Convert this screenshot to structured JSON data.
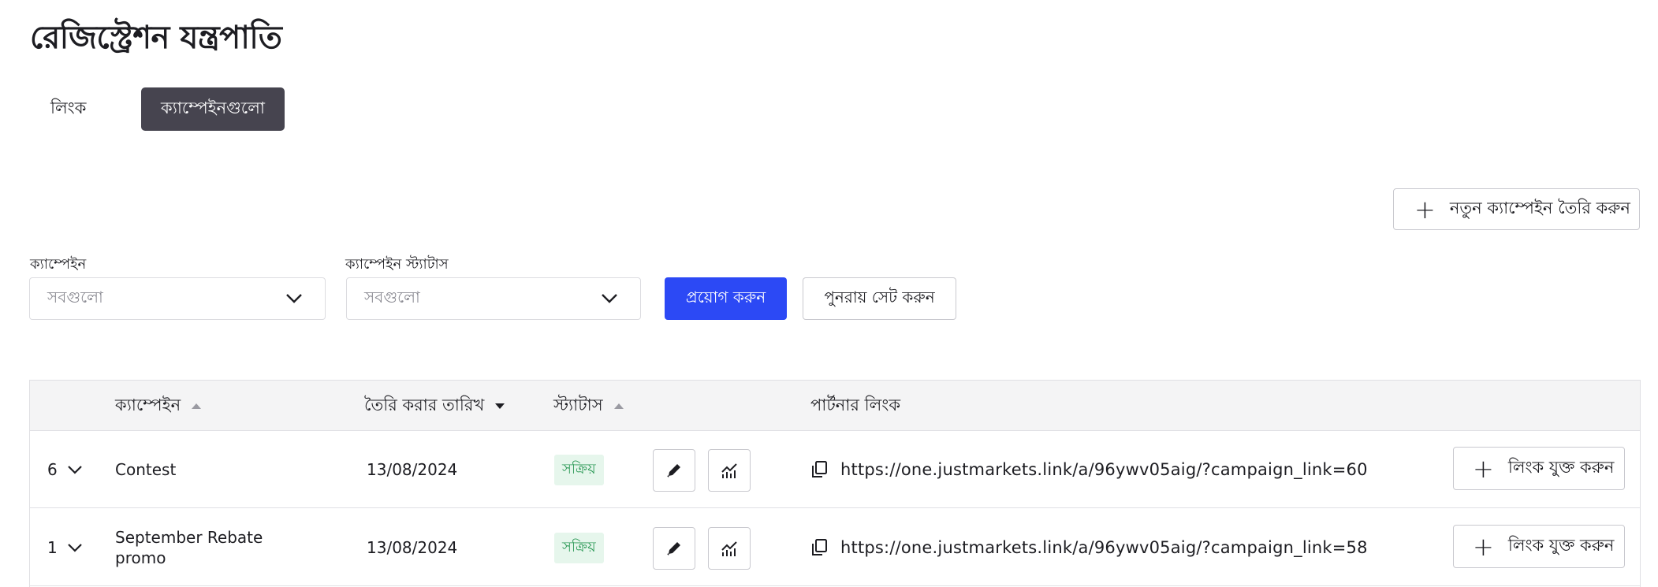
{
  "page": {
    "title": "রেজিস্ট্রেশন যন্ত্রপাতি"
  },
  "tabs": [
    {
      "label": "লিংক",
      "active": false
    },
    {
      "label": "ক্যাম্পেইনগুলো",
      "active": true
    }
  ],
  "actions": {
    "new_campaign": "নতুন ক্যাম্পেইন তৈরি করুন"
  },
  "filters": {
    "campaign": {
      "label": "ক্যাম্পেইন",
      "value": "সবগুলো"
    },
    "status": {
      "label": "ক্যাম্পেইন স্ট্যাটাস",
      "value": "সবগুলো"
    },
    "apply": "প্রয়োগ করুন",
    "reset": "পুনরায় সেট করুন"
  },
  "table": {
    "columns": {
      "campaign": "ক্যাম্পেইন",
      "created": "তৈরি করার তারিখ",
      "status": "স্ট্যাটাস",
      "partner_link": "পার্টনার লিংক"
    },
    "rows": [
      {
        "count": "6",
        "name": "Contest",
        "date": "13/08/2024",
        "status": "সক্রিয়",
        "link": "https://one.justmarkets.link/a/96ywv05aig/?campaign_link=60",
        "add_link": "লিংক যুক্ত করুন"
      },
      {
        "count": "1",
        "name_line1": "September Rebate",
        "name_line2": "promo",
        "date": "13/08/2024",
        "status": "সক্রিয়",
        "link": "https://one.justmarkets.link/a/96ywv05aig/?campaign_link=58",
        "add_link": "লিংক যুক্ত করুন"
      }
    ]
  },
  "colors": {
    "primary": "#2c49f5",
    "tab_active": "#46444f",
    "badge_bg": "#e6f6ec",
    "badge_text": "#2e9a58"
  }
}
